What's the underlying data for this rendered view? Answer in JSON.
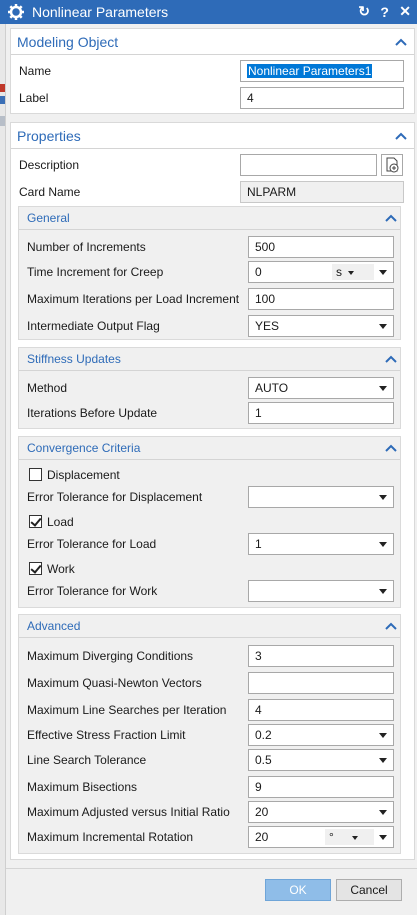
{
  "window": {
    "title": "Nonlinear Parameters",
    "icons": {
      "reset": "reset-icon",
      "help": "help-icon",
      "close": "close-icon"
    }
  },
  "modeling_object": {
    "title": "Modeling Object",
    "name_label": "Name",
    "name_value": "Nonlinear Parameters1",
    "label_label": "Label",
    "label_value": "4"
  },
  "properties": {
    "title": "Properties",
    "description_label": "Description",
    "description_value": "",
    "card_name_label": "Card Name",
    "card_name_value": "NLPARM"
  },
  "general": {
    "title": "General",
    "num_increments_label": "Number of Increments",
    "num_increments_value": "500",
    "time_increment_label": "Time Increment for Creep",
    "time_increment_value": "0",
    "time_increment_unit": "s",
    "max_iter_label": "Maximum Iterations per Load Increment",
    "max_iter_value": "100",
    "output_flag_label": "Intermediate Output Flag",
    "output_flag_value": "YES"
  },
  "stiffness": {
    "title": "Stiffness Updates",
    "method_label": "Method",
    "method_value": "AUTO",
    "iter_before_label": "Iterations Before Update",
    "iter_before_value": "1"
  },
  "convergence": {
    "title": "Convergence Criteria",
    "displacement_label": "Displacement",
    "displacement_checked": false,
    "err_disp_label": "Error Tolerance for Displacement",
    "err_disp_value": "",
    "load_label": "Load",
    "load_checked": true,
    "err_load_label": "Error Tolerance for Load",
    "err_load_value": "1",
    "work_label": "Work",
    "work_checked": true,
    "err_work_label": "Error Tolerance for Work",
    "err_work_value": ""
  },
  "advanced": {
    "title": "Advanced",
    "max_diverging_label": "Maximum Diverging Conditions",
    "max_diverging_value": "3",
    "max_qn_label": "Maximum Quasi-Newton Vectors",
    "max_qn_value": "",
    "max_line_label": "Maximum Line Searches per Iteration",
    "max_line_value": "4",
    "eff_stress_label": "Effective Stress Fraction Limit",
    "eff_stress_value": "0.2",
    "line_tol_label": "Line Search Tolerance",
    "line_tol_value": "0.5",
    "max_bisect_label": "Maximum Bisections",
    "max_bisect_value": "9",
    "max_adjusted_label": "Maximum Adjusted versus Initial Ratio",
    "max_adjusted_value": "20",
    "max_rotation_label": "Maximum Incremental Rotation",
    "max_rotation_value": "20",
    "max_rotation_unit": "°"
  },
  "footer": {
    "ok_label": "OK",
    "cancel_label": "Cancel"
  },
  "colors": {
    "titlebar": "#2e6bb8",
    "section_header": "#2e6bb8",
    "ok_button": "#8fbde8",
    "selection": "#0078d7"
  }
}
